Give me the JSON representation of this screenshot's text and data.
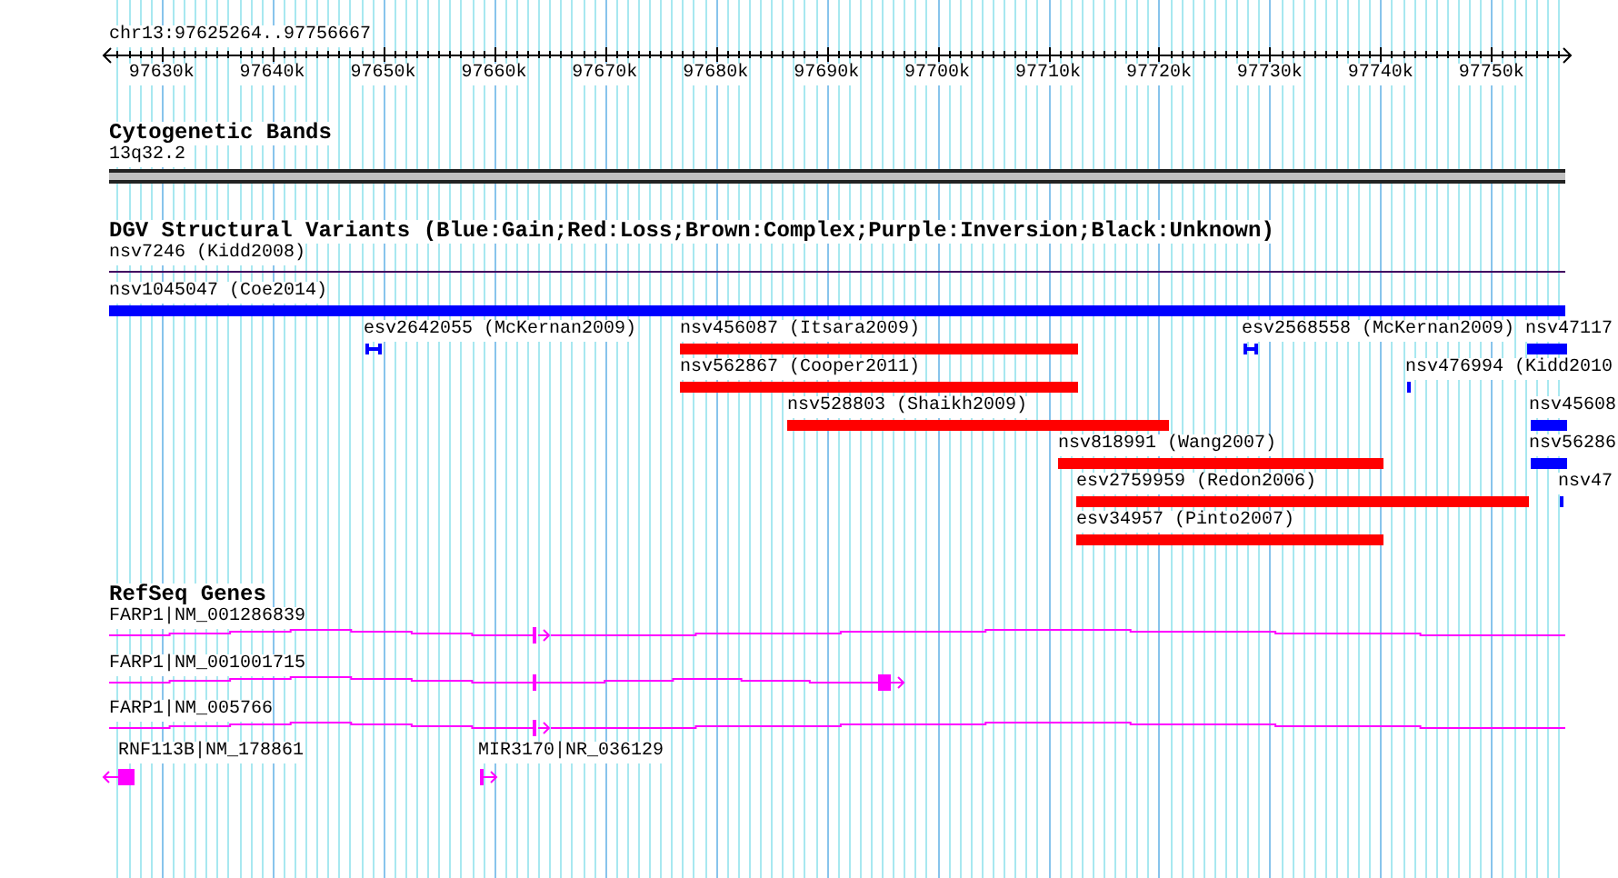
{
  "ruler": {
    "location": "chr13:97625264..97756667",
    "ticks": [
      "97630k",
      "97640k",
      "97650k",
      "97660k",
      "97670k",
      "97680k",
      "97690k",
      "97700k",
      "97710k",
      "97720k",
      "97730k",
      "97740k",
      "97750k"
    ]
  },
  "cytogenetic_bands": {
    "title": "Cytogenetic Bands",
    "band": "13q32.2"
  },
  "dgv_structural_variants": {
    "title": "DGV Structural Variants (Blue:Gain;Red:Loss;Brown:Complex;Purple:Inversion;Black:Unknown)",
    "features": [
      {
        "label": "nsv7246 (Kidd2008)",
        "kind": "line",
        "color": "#400060"
      },
      {
        "label": "nsv1045047 (Coe2014)",
        "kind": "bar",
        "color": "#0000ff"
      },
      {
        "label": "esv2642055 (McKernan2009)",
        "kind": "bracket",
        "color": "#0000ff"
      },
      {
        "label": "nsv456087 (Itsara2009)",
        "kind": "bar",
        "color": "#ff0000"
      },
      {
        "label": "esv2568558 (McKernan2009)",
        "kind": "bracket",
        "color": "#0000ff"
      },
      {
        "label": "nsv47117",
        "kind": "bar",
        "color": "#0000ff"
      },
      {
        "label": "nsv562867 (Cooper2011)",
        "kind": "bar",
        "color": "#ff0000"
      },
      {
        "label": "nsv476994 (Kidd2010",
        "kind": "bar",
        "color": "#0000ff"
      },
      {
        "label": "nsv528803 (Shaikh2009)",
        "kind": "bar",
        "color": "#ff0000"
      },
      {
        "label": "nsv45608",
        "kind": "bar",
        "color": "#0000ff"
      },
      {
        "label": "nsv818991 (Wang2007)",
        "kind": "bar",
        "color": "#ff0000"
      },
      {
        "label": "nsv56286",
        "kind": "bar",
        "color": "#0000ff"
      },
      {
        "label": "esv2759959 (Redon2006)",
        "kind": "bar",
        "color": "#ff0000"
      },
      {
        "label": "nsv47",
        "kind": "bar",
        "color": "#0000ff"
      },
      {
        "label": "esv34957 (Pinto2007)",
        "kind": "bar",
        "color": "#ff0000"
      }
    ]
  },
  "refseq_genes": {
    "title": "RefSeq Genes",
    "genes": [
      {
        "label": "FARP1|NM_001286839",
        "reverse": false
      },
      {
        "label": "FARP1|NM_001001715",
        "reverse": false
      },
      {
        "label": "FARP1|NM_005766",
        "reverse": false
      },
      {
        "label": "RNF113B|NM_178861",
        "reverse": true
      },
      {
        "label": "MIR3170|NR_036129",
        "reverse": false
      }
    ]
  }
}
